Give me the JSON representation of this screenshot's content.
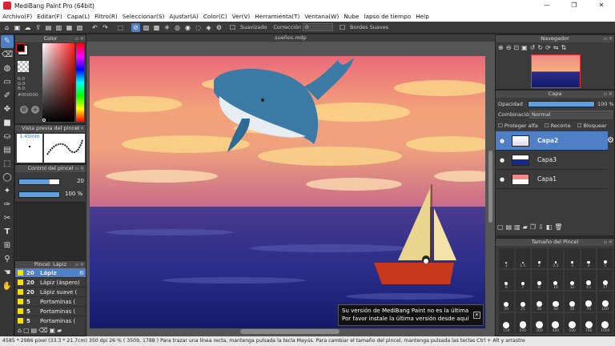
{
  "window": {
    "title": "MediBang Paint Pro (64bit)",
    "minimize": "—",
    "maximize": "❐",
    "close": "✕"
  },
  "menu": [
    "Archivo(F)",
    "Editar(F)",
    "Capa(L)",
    "Filtro(R)",
    "Seleccionar(S)",
    "Ajustar(A)",
    "Color(C)",
    "Ver(V)",
    "Herramienta(T)",
    "Ventana(W)",
    "Nube",
    "lapso de tiempo",
    "Help"
  ],
  "toolbar": {
    "smoothing_label": "Suavizado",
    "correction_label": "Corrección",
    "correction_value": "0",
    "soft_edges_label": "Bordes Suaves"
  },
  "color_panel": {
    "title": "Color",
    "r": "R:0",
    "g": "G:0",
    "b": "B:0",
    "hex": "#000000",
    "primary_color": "#000000",
    "secondary_color": "#ffffff"
  },
  "brush_preview": {
    "title": "Vista previa del pincel",
    "size": "1.45mm"
  },
  "brush_control": {
    "title": "Control del pincel",
    "size_value": "20",
    "opacity_value": "100",
    "opacity_unit": "%",
    "size_level": 0.75,
    "opacity_level": 1.0
  },
  "brush_list": {
    "title": "Pincel: Lápiz",
    "items": [
      {
        "size": "20",
        "name": "Lápiz"
      },
      {
        "size": "20",
        "name": "Lápiz (áspero)"
      },
      {
        "size": "20",
        "name": "Lápiz suave ("
      },
      {
        "size": "5",
        "name": "Portaminas ("
      },
      {
        "size": "5",
        "name": "Portaminas ("
      },
      {
        "size": "5",
        "name": "Portaminas ("
      }
    ]
  },
  "document": {
    "filename": "sueños.mdp"
  },
  "navigator": {
    "title": "Navegador"
  },
  "layers": {
    "title": "Capa",
    "opacity_label": "Opacidad",
    "opacity_value": "100 %",
    "blend_label": "Combinación",
    "blend_value": "Normal",
    "protect_alpha": "Proteger alfa",
    "clip": "Recorte",
    "lock": "Bloquear",
    "items": [
      {
        "name": "Capa2"
      },
      {
        "name": "Capa3"
      },
      {
        "name": "Capa1"
      }
    ]
  },
  "brush_size_panel": {
    "title": "Tamaño del Pincel",
    "sizes": [
      "1",
      "1.5",
      "2",
      "2.5",
      "3",
      "4",
      "5",
      "6",
      "7",
      "8",
      "10",
      "12",
      "15",
      "17",
      "20",
      "25",
      "30",
      "40",
      "50",
      "70",
      "100",
      "150",
      "200",
      "300",
      "400",
      "500",
      "700",
      "1000"
    ]
  },
  "notice": {
    "line1": "Su versión de MediBang Paint no es la última",
    "line2": "Por favor instale la última versión desde aquí",
    "close": "✕"
  },
  "status": {
    "text": "4585 * 2986 pixel   (33.3 * 21.7cm)   350 dpi   26 %   ( 3509, 1788 )   Para trazar una línea recta, mantenga pulsada la tecla Mayús. Para cambiar el tamaño del pincel, mantenga pulsada las teclas Ctrl + Alt y arrastre"
  },
  "colors": {
    "accent": "#4f7fc4",
    "panel_bg": "#3b3b3b",
    "brush_swatch": "#f5e000"
  }
}
